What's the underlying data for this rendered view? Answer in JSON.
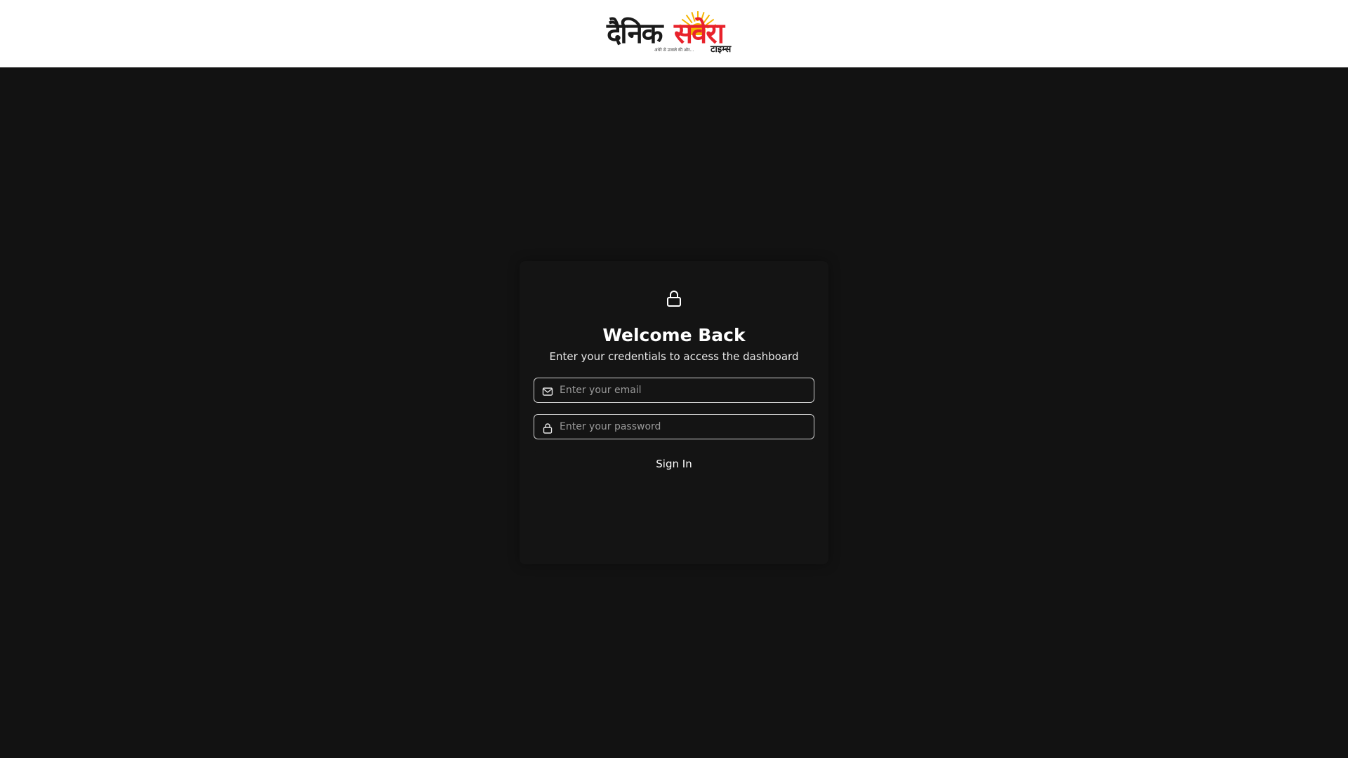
{
  "header": {
    "logo": {
      "word_black": "दैनिक",
      "word_red": "सवेरा",
      "tagline": "अंधेरे से उजाले की ओर...",
      "suffix": "टाइम्स",
      "sun_icon": "sun-icon",
      "colors": {
        "black": "#1a1a1a",
        "red": "#e8222b",
        "sun": "#f5b400"
      }
    }
  },
  "login": {
    "header_icon": "lock-icon",
    "title": "Welcome Back",
    "subtitle": "Enter your credentials to access the dashboard",
    "email": {
      "icon": "mail-icon",
      "placeholder": "Enter your email",
      "value": ""
    },
    "password": {
      "icon": "lock-icon",
      "placeholder": "Enter your password",
      "value": ""
    },
    "submit_label": "Sign In"
  },
  "theme": {
    "page_background": "#121212",
    "card_background": "#141414",
    "header_background": "#ffffff",
    "text_primary": "#ffffff",
    "border": "#cfcfcf"
  }
}
